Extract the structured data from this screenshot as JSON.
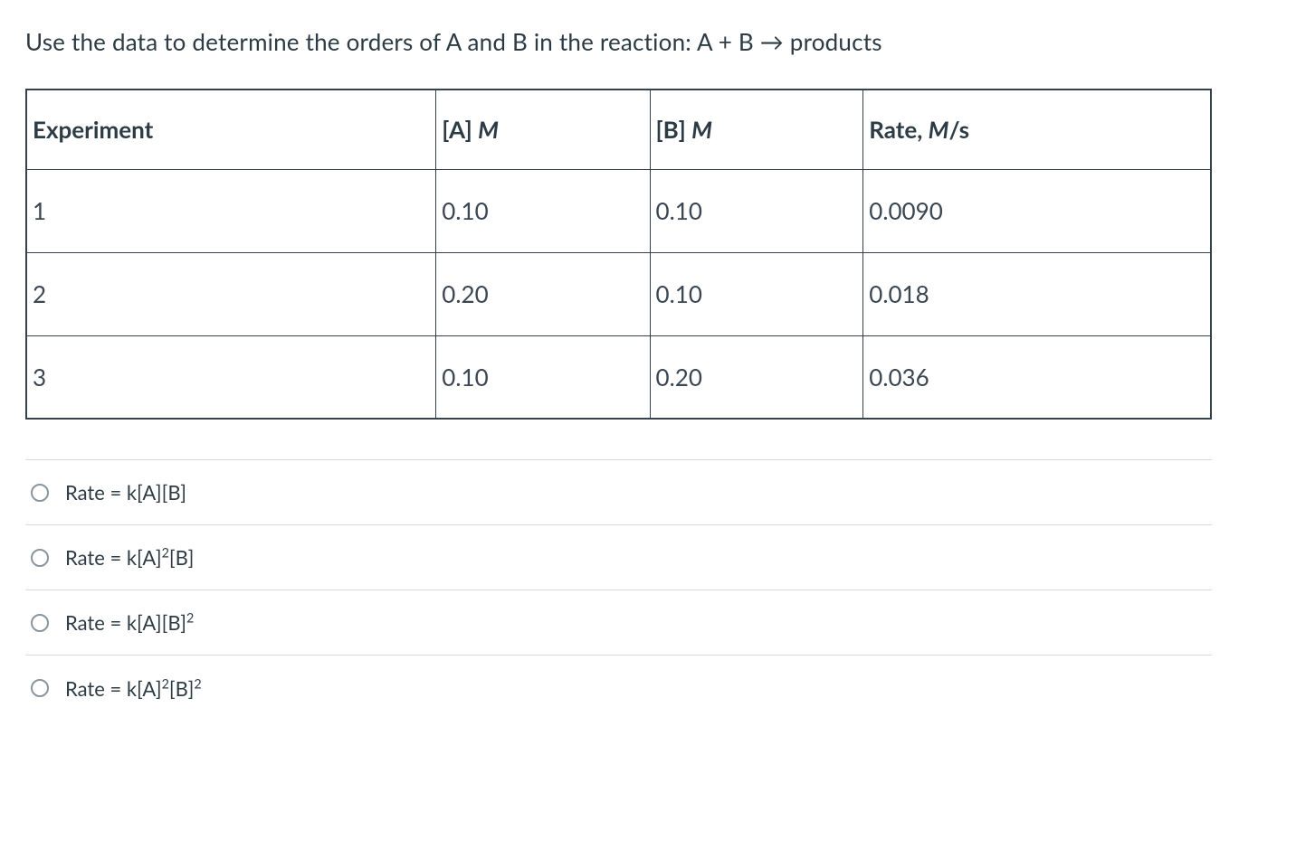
{
  "question": "Use the data to determine the orders of A and B in the reaction: A + B → products",
  "table": {
    "headers": {
      "col1": "Experiment",
      "col2_pre": "[A] ",
      "col2_ital": "M",
      "col3_pre": "[B] ",
      "col3_ital": "M",
      "col4_pre": "Rate, ",
      "col4_ital": "M",
      "col4_post": "/s"
    },
    "rows": [
      {
        "exp": "1",
        "a": "0.10",
        "b": "0.10",
        "rate": "0.0090"
      },
      {
        "exp": "2",
        "a": "0.20",
        "b": "0.10",
        "rate": "0.018"
      },
      {
        "exp": "3",
        "a": "0.10",
        "b": "0.20",
        "rate": "0.036"
      }
    ]
  },
  "answers": {
    "opt1": {
      "pre": "Rate = k[A][B]",
      "sup1": "",
      "mid": "",
      "sup2": ""
    },
    "opt2": {
      "pre": "Rate = k[A]",
      "sup1": "2",
      "mid": "[B]",
      "sup2": ""
    },
    "opt3": {
      "pre": "Rate = k[A][B]",
      "sup1": "2",
      "mid": "",
      "sup2": ""
    },
    "opt4": {
      "pre": "Rate = k[A]",
      "sup1": "2",
      "mid": "[B]",
      "sup2": "2"
    }
  },
  "chart_data": {
    "type": "table",
    "columns": [
      "Experiment",
      "[A] M",
      "[B] M",
      "Rate, M/s"
    ],
    "rows": [
      [
        1,
        0.1,
        0.1,
        0.009
      ],
      [
        2,
        0.2,
        0.1,
        0.018
      ],
      [
        3,
        0.1,
        0.2,
        0.036
      ]
    ]
  }
}
